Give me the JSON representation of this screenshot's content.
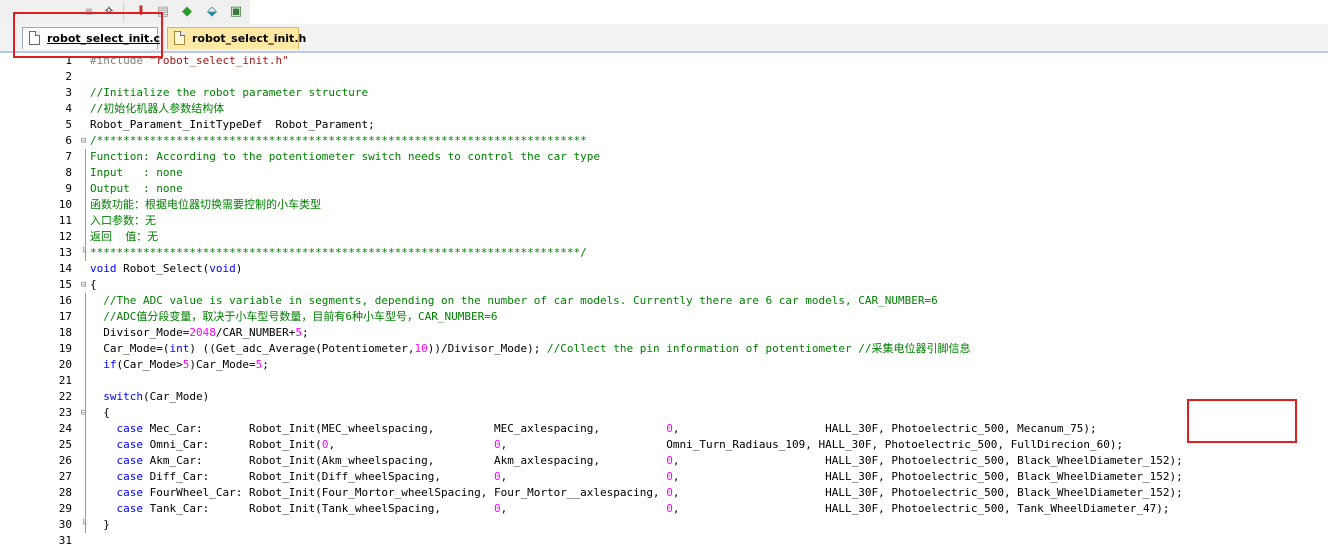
{
  "toolbar": {
    "icons": [
      "disabled-icon",
      "magic-wand-icon",
      "download-icon",
      "printer-icon",
      "target-icon",
      "insert-icon",
      "build-icon"
    ]
  },
  "tabs": [
    {
      "label": "robot_select_init.c",
      "active": true
    },
    {
      "label": "robot_select_init.h",
      "active": false
    }
  ],
  "editor": {
    "lines": [
      {
        "n": "1",
        "segs": [
          [
            "pp",
            "#include "
          ],
          [
            "str",
            "\"robot_select_init.h\""
          ]
        ]
      },
      {
        "n": "2",
        "segs": []
      },
      {
        "n": "3",
        "segs": [
          [
            "cmt",
            "//Initialize the robot parameter structure"
          ]
        ]
      },
      {
        "n": "4",
        "segs": [
          [
            "cmt",
            "//初始化机器人参数结构体"
          ]
        ]
      },
      {
        "n": "5",
        "segs": [
          [
            "txt",
            "Robot_Parament_InitTypeDef  Robot_Parament;"
          ]
        ]
      },
      {
        "n": "6",
        "segs": [
          [
            "cmt",
            "/**************************************************************************"
          ]
        ]
      },
      {
        "n": "7",
        "segs": [
          [
            "cmt",
            "Function: According to the potentiometer switch needs to control the car type"
          ]
        ]
      },
      {
        "n": "8",
        "segs": [
          [
            "cmt",
            "Input   : none"
          ]
        ]
      },
      {
        "n": "9",
        "segs": [
          [
            "cmt",
            "Output  : none"
          ]
        ]
      },
      {
        "n": "10",
        "segs": [
          [
            "cmt",
            "函数功能：根据电位器切换需要控制的小车类型"
          ]
        ]
      },
      {
        "n": "11",
        "segs": [
          [
            "cmt",
            "入口参数：无"
          ]
        ]
      },
      {
        "n": "12",
        "segs": [
          [
            "cmt",
            "返回  值：无"
          ]
        ]
      },
      {
        "n": "13",
        "segs": [
          [
            "cmt",
            "**************************************************************************/"
          ]
        ]
      },
      {
        "n": "14",
        "segs": [
          [
            "kw",
            "void"
          ],
          [
            "txt",
            " Robot_Select("
          ],
          [
            "kw",
            "void"
          ],
          [
            "txt",
            ")"
          ]
        ]
      },
      {
        "n": "15",
        "segs": [
          [
            "txt",
            "{"
          ]
        ]
      },
      {
        "n": "16",
        "segs": [
          [
            "txt",
            "  "
          ],
          [
            "cmt",
            "//The ADC value is variable in segments, depending on the number of car models. Currently there are 6 car models, CAR_NUMBER=6"
          ]
        ]
      },
      {
        "n": "17",
        "segs": [
          [
            "txt",
            "  "
          ],
          [
            "cmt",
            "//ADC值分段变量，取决于小车型号数量，目前有6种小车型号，CAR_NUMBER=6"
          ]
        ]
      },
      {
        "n": "18",
        "segs": [
          [
            "txt",
            "  Divisor_Mode="
          ],
          [
            "num",
            "2048"
          ],
          [
            "txt",
            "/CAR_NUMBER+"
          ],
          [
            "num",
            "5"
          ],
          [
            "txt",
            ";"
          ]
        ]
      },
      {
        "n": "19",
        "segs": [
          [
            "txt",
            "  Car_Mode=("
          ],
          [
            "kw",
            "int"
          ],
          [
            "txt",
            ") ((Get_adc_Average(Potentiometer,"
          ],
          [
            "num",
            "10"
          ],
          [
            "txt",
            "))/Divisor_Mode); "
          ],
          [
            "cmt",
            "//Collect the pin information of potentiometer //采集电位器引脚信息"
          ]
        ]
      },
      {
        "n": "20",
        "segs": [
          [
            "txt",
            "  "
          ],
          [
            "kw",
            "if"
          ],
          [
            "txt",
            "(Car_Mode>"
          ],
          [
            "num",
            "5"
          ],
          [
            "txt",
            ")Car_Mode="
          ],
          [
            "num",
            "5"
          ],
          [
            "txt",
            ";"
          ]
        ]
      },
      {
        "n": "21",
        "segs": []
      },
      {
        "n": "22",
        "segs": [
          [
            "txt",
            "  "
          ],
          [
            "kw",
            "switch"
          ],
          [
            "txt",
            "(Car_Mode)"
          ]
        ]
      },
      {
        "n": "23",
        "segs": [
          [
            "txt",
            "  {"
          ]
        ]
      },
      {
        "n": "24",
        "segs": [
          [
            "txt",
            "    "
          ],
          [
            "kw",
            "case"
          ],
          [
            "txt",
            " Mec_Car:       Robot_Init(MEC_wheelspacing,         MEC_axlespacing,          "
          ],
          [
            "num",
            "0"
          ],
          [
            "txt",
            ",                      HALL_30F, Photoelectric_500, Mecanum_75);"
          ]
        ]
      },
      {
        "n": "25",
        "segs": [
          [
            "txt",
            "    "
          ],
          [
            "kw",
            "case"
          ],
          [
            "txt",
            " Omni_Car:      Robot_Init("
          ],
          [
            "num",
            "0"
          ],
          [
            "txt",
            ",                        "
          ],
          [
            "num",
            "0"
          ],
          [
            "txt",
            ",                        Omni_Turn_Radiaus_109, HALL_30F, Photoelectric_500, FullDirecion_60);"
          ]
        ]
      },
      {
        "n": "26",
        "segs": [
          [
            "txt",
            "    "
          ],
          [
            "kw",
            "case"
          ],
          [
            "txt",
            " Akm_Car:       Robot_Init(Akm_wheelspacing,         Akm_axlespacing,          "
          ],
          [
            "num",
            "0"
          ],
          [
            "txt",
            ",                      HALL_30F, Photoelectric_500, Black_WheelDiameter_152);"
          ]
        ]
      },
      {
        "n": "27",
        "segs": [
          [
            "txt",
            "    "
          ],
          [
            "kw",
            "case"
          ],
          [
            "txt",
            " Diff_Car:      Robot_Init(Diff_wheelSpacing,        "
          ],
          [
            "num",
            "0"
          ],
          [
            "txt",
            ",                        "
          ],
          [
            "num",
            "0"
          ],
          [
            "txt",
            ",                      HALL_30F, Photoelectric_500, Black_WheelDiameter_152);"
          ]
        ]
      },
      {
        "n": "28",
        "segs": [
          [
            "txt",
            "    "
          ],
          [
            "kw",
            "case"
          ],
          [
            "txt",
            " FourWheel_Car: Robot_Init(Four_Mortor_wheelSpacing, Four_Mortor__axlespacing, "
          ],
          [
            "num",
            "0"
          ],
          [
            "txt",
            ",                      HALL_30F, Photoelectric_500, Black_WheelDiameter_152);"
          ]
        ]
      },
      {
        "n": "29",
        "segs": [
          [
            "txt",
            "    "
          ],
          [
            "kw",
            "case"
          ],
          [
            "txt",
            " Tank_Car:      Robot_Init(Tank_wheelSpacing,        "
          ],
          [
            "num",
            "0"
          ],
          [
            "txt",
            ",                        "
          ],
          [
            "num",
            "0"
          ],
          [
            "txt",
            ",                      HALL_30F, Photoelectric_500, Tank_WheelDiameter_47);"
          ]
        ]
      },
      {
        "n": "30",
        "segs": [
          [
            "txt",
            "  }"
          ]
        ]
      },
      {
        "n": "31",
        "segs": []
      }
    ]
  },
  "colors": {
    "comment": "#008000",
    "keyword": "#0000ff",
    "number": "#ff00ff",
    "string": "#a31515",
    "highlight": "#e02020"
  }
}
